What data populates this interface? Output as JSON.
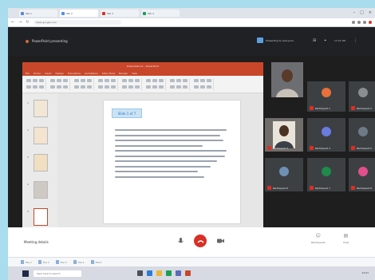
{
  "browser": {
    "tabs": [
      {
        "label": "Tab 1",
        "color": "#5b87d6"
      },
      {
        "label": "Tab 2",
        "color": "#4c8bf5"
      },
      {
        "label": "Tab 3",
        "color": "#d93025"
      },
      {
        "label": "Tab 4",
        "color": "#1a9e55"
      }
    ],
    "url": "meet.google.com"
  },
  "meet": {
    "room_title": "PowerPoint presenting",
    "presenting_label": "Presenting to everyone",
    "time": "12:01 PM"
  },
  "ppt": {
    "title": "Presentation1 - PowerPoint",
    "menu": [
      "File",
      "Home",
      "Insert",
      "Design",
      "Transitions",
      "Animations",
      "Slide Show",
      "Review",
      "View"
    ],
    "slide_heading": "Slide 1 of 7",
    "thumb_numbers": [
      "1",
      "2",
      "3",
      "4",
      "5"
    ],
    "thumb_colors": [
      "#f2e6d4",
      "#f3e3cf",
      "#f1dfc2",
      "#d9d4cf",
      "#ffffff"
    ]
  },
  "participants": [
    {
      "name": "Participant 1",
      "color": "#e8703a"
    },
    {
      "name": "Participant 2",
      "color": "#5f6368"
    },
    {
      "name": "Participant 3",
      "color": "#8c8f94"
    },
    {
      "name": "Participant 4",
      "color": "#6a7ce0"
    },
    {
      "name": "Participant 5",
      "color": "#6e7a86"
    },
    {
      "name": "Participant 6",
      "color": "#6f8fb4"
    },
    {
      "name": "Participant 7",
      "color": "#1e8a4c"
    },
    {
      "name": "Participant 8",
      "color": "#e24f8c"
    }
  ],
  "controls": {
    "meeting_details": "Meeting details",
    "right_labels": [
      "Participants",
      "Chat"
    ]
  },
  "downloads": [
    "File 1",
    "File 2",
    "File 3",
    "File 4",
    "File 5"
  ],
  "taskbar": {
    "search_placeholder": "Type here to search",
    "tray_time": "12:01"
  }
}
